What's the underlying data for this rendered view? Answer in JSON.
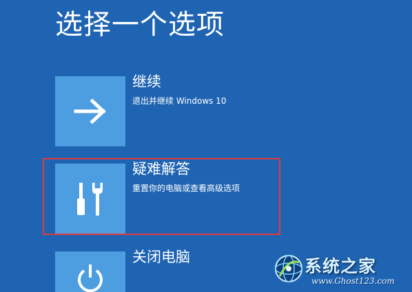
{
  "page": {
    "title": "选择一个选项"
  },
  "options": [
    {
      "id": "continue",
      "label": "继续",
      "description": "退出并继续 Windows 10",
      "icon": "arrow-right-icon"
    },
    {
      "id": "troubleshoot",
      "label": "疑难解答",
      "description": "重置你的电脑或查看高级选项",
      "icon": "tools-icon"
    },
    {
      "id": "shutdown",
      "label": "关闭电脑",
      "description": "",
      "icon": "power-icon"
    }
  ],
  "watermark": {
    "brand": "系统之家",
    "site": "www.Ghost123.com"
  },
  "colors": {
    "background": "#1f64b3",
    "tile": "#4d9ee1",
    "text": "#ffffff",
    "highlight_border": "#e43a3a"
  }
}
